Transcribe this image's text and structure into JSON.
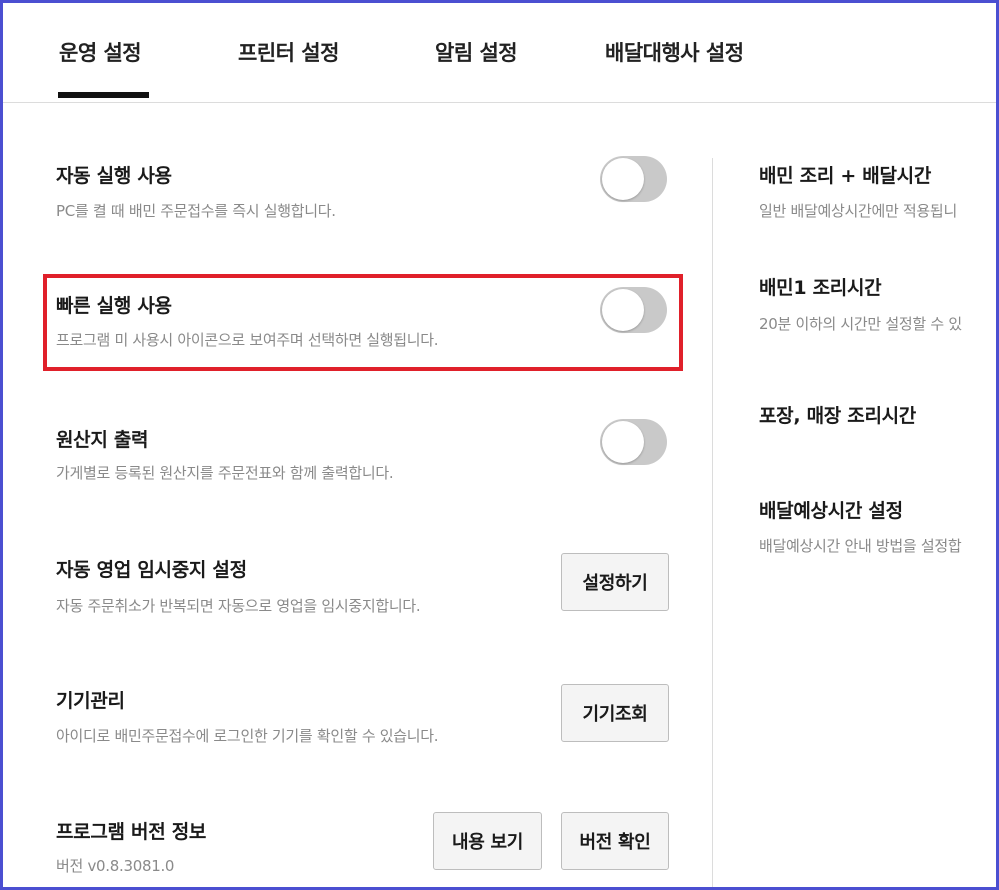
{
  "tabs": [
    {
      "label": "운영 설정",
      "active": true
    },
    {
      "label": "프린터 설정",
      "active": false
    },
    {
      "label": "알림 설정",
      "active": false
    },
    {
      "label": "배달대행사 설정",
      "active": false
    }
  ],
  "left_settings": {
    "auto_run": {
      "title": "자동 실행 사용",
      "desc": "PC를 켤 때 배민 주문접수를 즉시 실행합니다.",
      "enabled": false
    },
    "quick_run": {
      "title": "빠른 실행 사용",
      "desc": "프로그램 미 사용시 아이콘으로 보여주며 선택하면 실행됩니다.",
      "enabled": false
    },
    "origin_print": {
      "title": "원산지 출력",
      "desc": "가게별로 등록된 원산지를 주문전표와 함께 출력합니다.",
      "enabled": false
    },
    "auto_pause": {
      "title": "자동 영업 임시중지 설정",
      "desc": "자동 주문취소가 반복되면 자동으로 영업을 임시중지합니다.",
      "button": "설정하기"
    },
    "device_manage": {
      "title": "기기관리",
      "desc": "아이디로 배민주문접수에 로그인한 기기를 확인할 수 있습니다.",
      "button": "기기조회"
    },
    "version_info": {
      "title": "프로그램 버전 정보",
      "desc": "버전 v0.8.3081.0",
      "button_view": "내용 보기",
      "button_check": "버전 확인"
    }
  },
  "right_settings": {
    "cook_delivery": {
      "title": "배민 조리 + 배달시간",
      "desc": "일반 배달예상시간에만 적용됩니"
    },
    "baemin1_cook": {
      "title": "배민1 조리시간",
      "desc": "20분 이하의 시간만 설정할 수 있"
    },
    "pack_cook": {
      "title": "포장, 매장 조리시간"
    },
    "delivery_eta": {
      "title": "배달예상시간 설정",
      "desc": "배달예상시간 안내 방법을 설정합"
    }
  },
  "colors": {
    "frame_border": "#4b4fd1",
    "highlight_border": "#e0202a",
    "toggle_off": "#c9c9c9",
    "active_tab_underline": "#111111"
  }
}
